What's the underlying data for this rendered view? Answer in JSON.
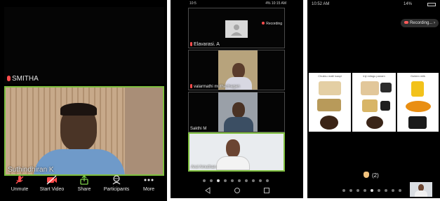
{
  "left_panel": {
    "top_participant": "SMITHA",
    "active_participant": "Suthindhiran K",
    "toolbar": [
      {
        "label": "Unmute",
        "icon": "mic-muted-icon"
      },
      {
        "label": "Start Video",
        "icon": "video-off-icon"
      },
      {
        "label": "Share",
        "icon": "share-icon"
      },
      {
        "label": "Participants",
        "icon": "participants-icon"
      },
      {
        "label": "More",
        "icon": "more-icon"
      }
    ]
  },
  "middle_panel": {
    "status_left": "10:5",
    "status_right": "4% 10:15 AM",
    "recording_label": "Recording",
    "participants": [
      "Elavarasi. A",
      "valarmathi muthazhagan",
      "Sakthi M",
      "Arul Amuthan"
    ]
  },
  "right_panel": {
    "time": "10:52 AM",
    "status_right": "14%",
    "recording_label": "Recording...",
    "cards": [
      "Chukku malli kaapi",
      "Inji milagu panam",
      "Golden milk"
    ],
    "raised_hands": "(2)"
  },
  "colors": {
    "active_border": "#7fbf3f",
    "muted_red": "#ff4d4d",
    "background": "#000000"
  }
}
